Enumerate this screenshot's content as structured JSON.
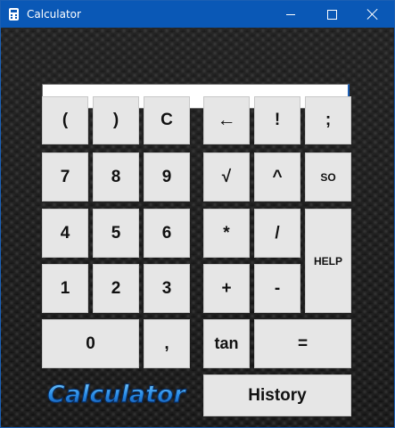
{
  "window": {
    "title": "Calculator"
  },
  "display": {
    "value": ""
  },
  "logo": {
    "text": "Calculator",
    "color": "#2a8ee8"
  },
  "keys": {
    "lparen": "(",
    "rparen": ")",
    "clear": "C",
    "backspace": "←",
    "factorial": "!",
    "semicolon": ";",
    "seven": "7",
    "eight": "8",
    "nine": "9",
    "sqrt": "√",
    "power": "^",
    "so": "SO",
    "four": "4",
    "five": "5",
    "six": "6",
    "multiply": "*",
    "divide": "/",
    "help": "HELP",
    "one": "1",
    "two": "2",
    "three": "3",
    "plus": "+",
    "minus": "-",
    "zero": "0",
    "comma": ",",
    "tan": "tan",
    "equals": "=",
    "history": "History"
  }
}
